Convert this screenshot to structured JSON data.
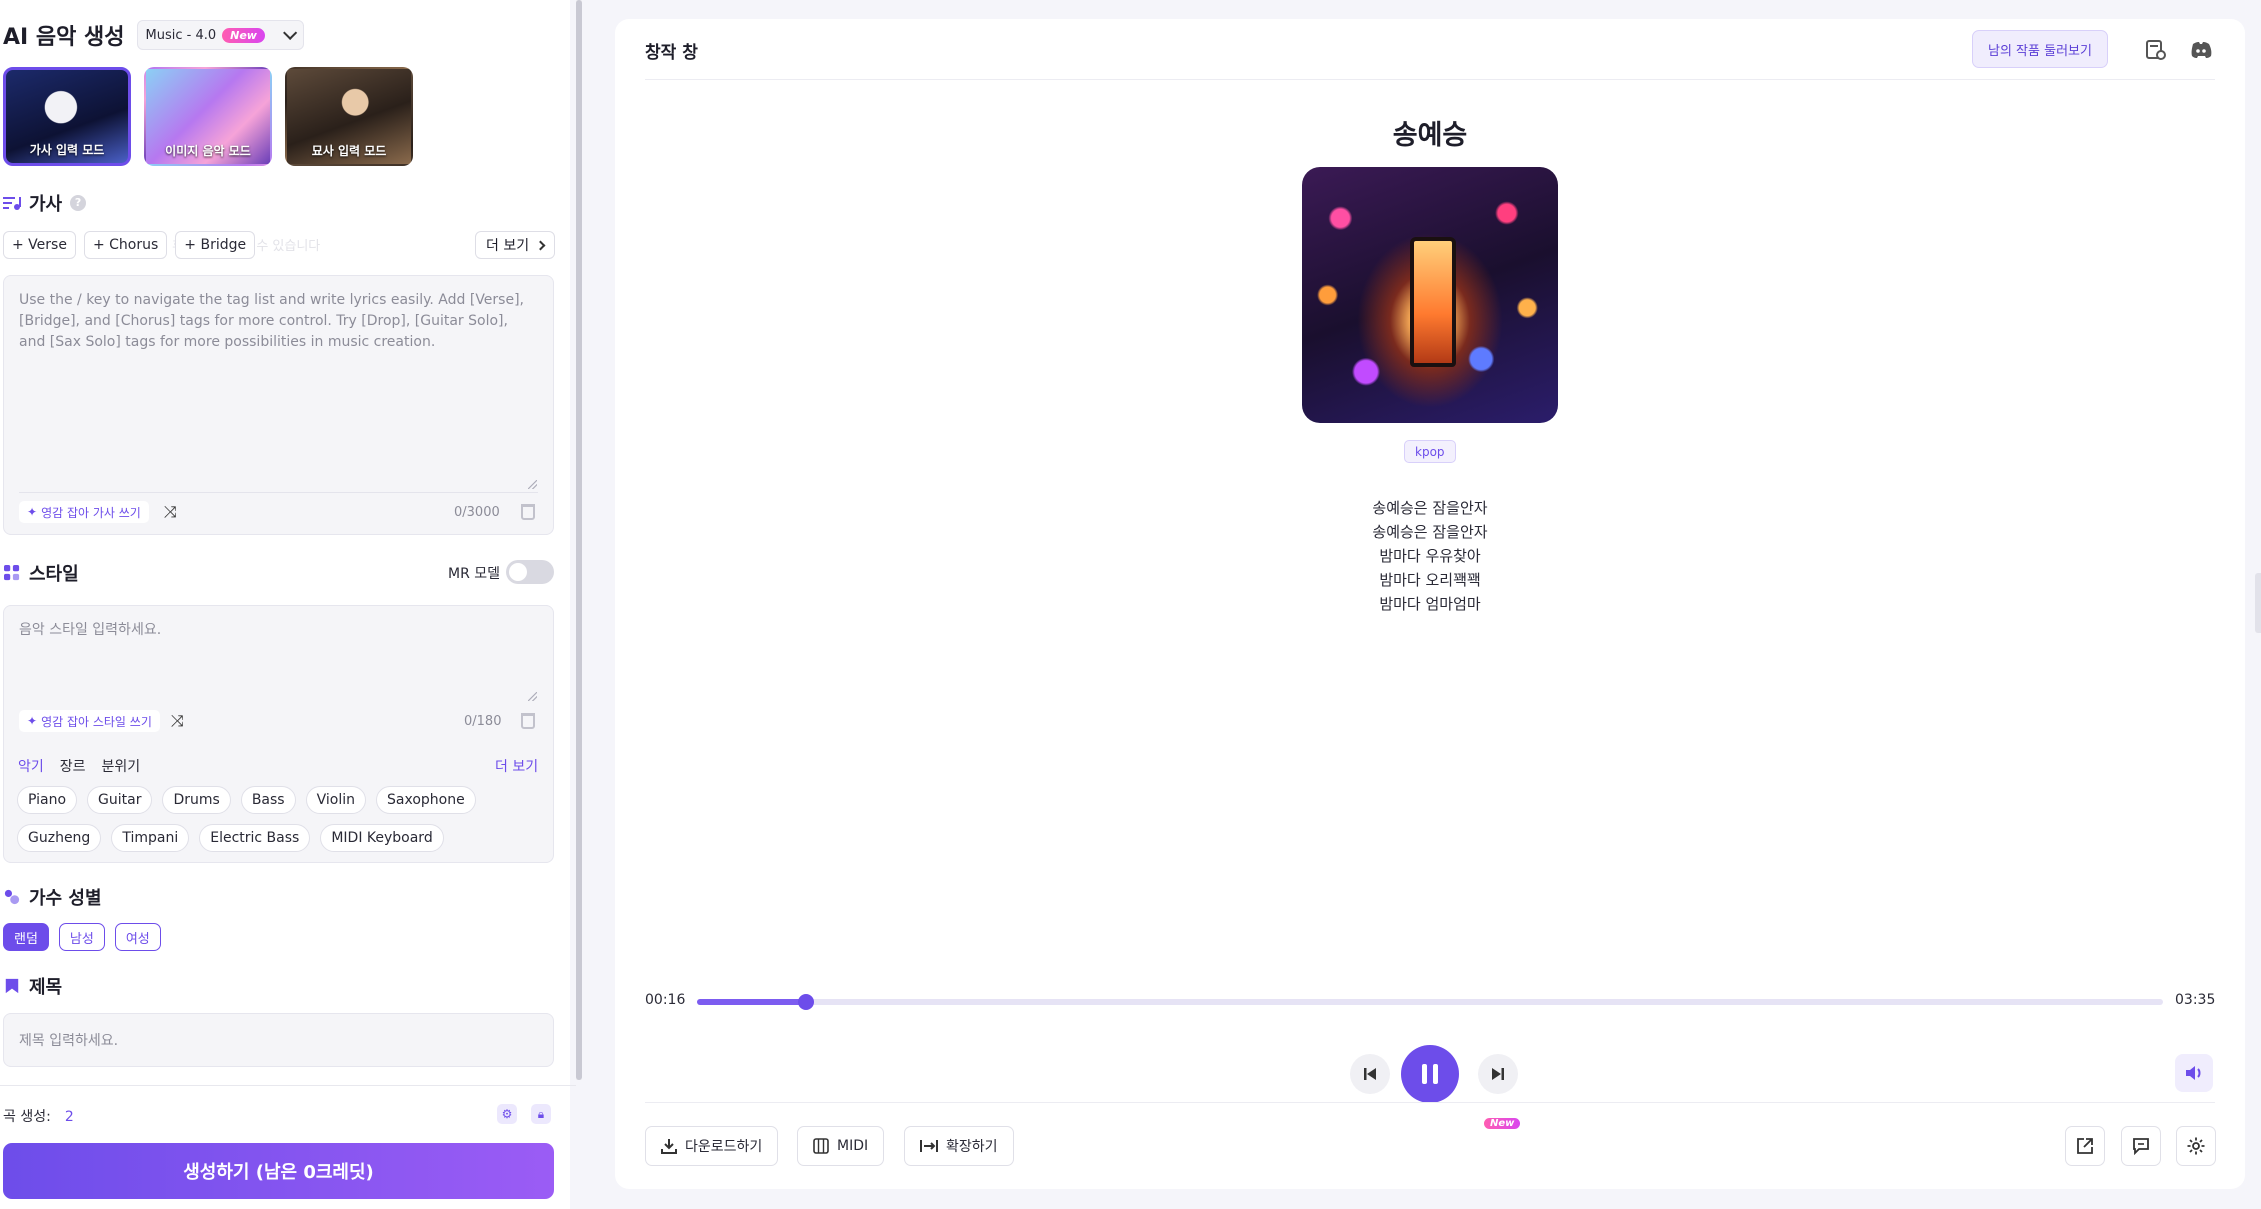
{
  "app": {
    "title": "AI 음악 생성",
    "model": "Music - 4.0",
    "model_badge": "New"
  },
  "modes": [
    {
      "label": "가사 입력 모드",
      "active": true
    },
    {
      "label": "이미지 음악 모드",
      "active": false
    },
    {
      "label": "묘사 입력 모드",
      "active": false
    }
  ],
  "lyrics_section": {
    "title": "가사",
    "help": "?",
    "tags": [
      "+ Verse",
      "+ Chorus",
      "+ Bridge"
    ],
    "more": "더 보기",
    "ghost_hint": "다른 곡 판권의 휴레를 더욱 볼 수 있습니다",
    "placeholder": "Use the / key to navigate the tag list and write lyrics easily. Add [Verse], [Bridge], and [Chorus] tags for more control. Try [Drop], [Guitar Solo], and [Sax Solo] tags for more possibilities in music creation.",
    "ai_button": "영감 잡아 가사 쓰기",
    "counter": "0/3000"
  },
  "style_section": {
    "title": "스타일",
    "mr_label": "MR 모델",
    "placeholder": "음악 스타일 입력하세요.",
    "ai_button": "영감 잡아 스타일 쓰기",
    "counter": "0/180",
    "tabs": [
      "악기",
      "장르",
      "분위기"
    ],
    "more": "더 보기",
    "chips_row1": [
      "Piano",
      "Guitar",
      "Drums",
      "Bass",
      "Violin",
      "Saxophone"
    ],
    "chips_row2": [
      "Guzheng",
      "Timpani",
      "Electric Bass",
      "MIDI Keyboard"
    ]
  },
  "gender_section": {
    "title": "가수 성별",
    "options": [
      "랜덤",
      "남성",
      "여성"
    ],
    "selected": "랜덤"
  },
  "title_section": {
    "title": "제목",
    "placeholder": "제목 입력하세요."
  },
  "footer": {
    "count_label": "곡 생성:",
    "count_value": "2",
    "generate": "생성하기 (남은 0크레딧)"
  },
  "right": {
    "title": "창작 창",
    "browse": "남의 작품 둘러보기",
    "song_title": "송예승",
    "genre": "kpop",
    "lyrics": [
      "송예승은 잠을안자",
      "송예승은 잠을안자",
      "밤마다 우유찾아",
      "밤마다 오리꽥꽥",
      "밤마다 엄마엄마"
    ],
    "time_current": "00:16",
    "time_total": "03:35",
    "progress": 0.0744,
    "actions": {
      "download": "다운로드하기",
      "midi": "MIDI",
      "midi_badge": "New",
      "extend": "확장하기"
    }
  },
  "colors": {
    "accent": "#6d4dea",
    "badge": "#ff5db1"
  }
}
